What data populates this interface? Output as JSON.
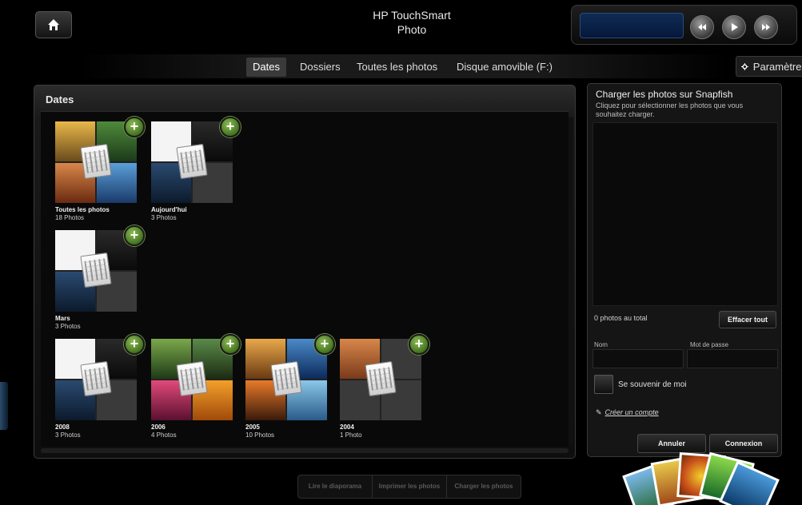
{
  "header": {
    "title_line1": "HP TouchSmart",
    "title_line2": "Photo",
    "home_icon": "home-icon",
    "media_controls": [
      "rewind-icon",
      "play-icon",
      "fast-forward-icon"
    ]
  },
  "nav": {
    "tabs": [
      {
        "label": "Dates",
        "active": true
      },
      {
        "label": "Dossiers",
        "active": false
      },
      {
        "label": "Toutes les photos",
        "active": false
      },
      {
        "label": "Disque amovible (F:)",
        "active": false
      }
    ],
    "settings_label": "Paramètres"
  },
  "dates_panel": {
    "title": "Dates",
    "tiles": [
      {
        "title": "Toutes les photos",
        "count": "18 Photos"
      },
      {
        "title": "Aujourd'hui",
        "count": "3 Photos"
      },
      {
        "title": "Mars",
        "count": "3 Photos"
      },
      {
        "title": "2008",
        "count": "3 Photos"
      },
      {
        "title": "2006",
        "count": "4 Photos"
      },
      {
        "title": "2005",
        "count": "10 Photos"
      },
      {
        "title": "2004",
        "count": "1 Photo"
      }
    ]
  },
  "upload": {
    "title": "Charger les photos sur Snapfish",
    "hint": "Cliquez pour sélectionner les photos que vous souhaitez charger.",
    "total": "0 photos au total",
    "clear_label": "Effacer tout",
    "name_label": "Nom",
    "password_label": "Mot de passe",
    "remember_label": "Se souvenir de moi",
    "create_account": "Créer un compte",
    "cancel_label": "Annuler",
    "login_label": "Connexion"
  },
  "bottom_bar": {
    "slideshow": "Lire le diaporama",
    "print": "Imprimer les photos",
    "upload": "Charger les photos"
  },
  "colors": {
    "accent_green": "#4f8a25",
    "media_screen": "#0f2b55",
    "background": "#000000"
  }
}
